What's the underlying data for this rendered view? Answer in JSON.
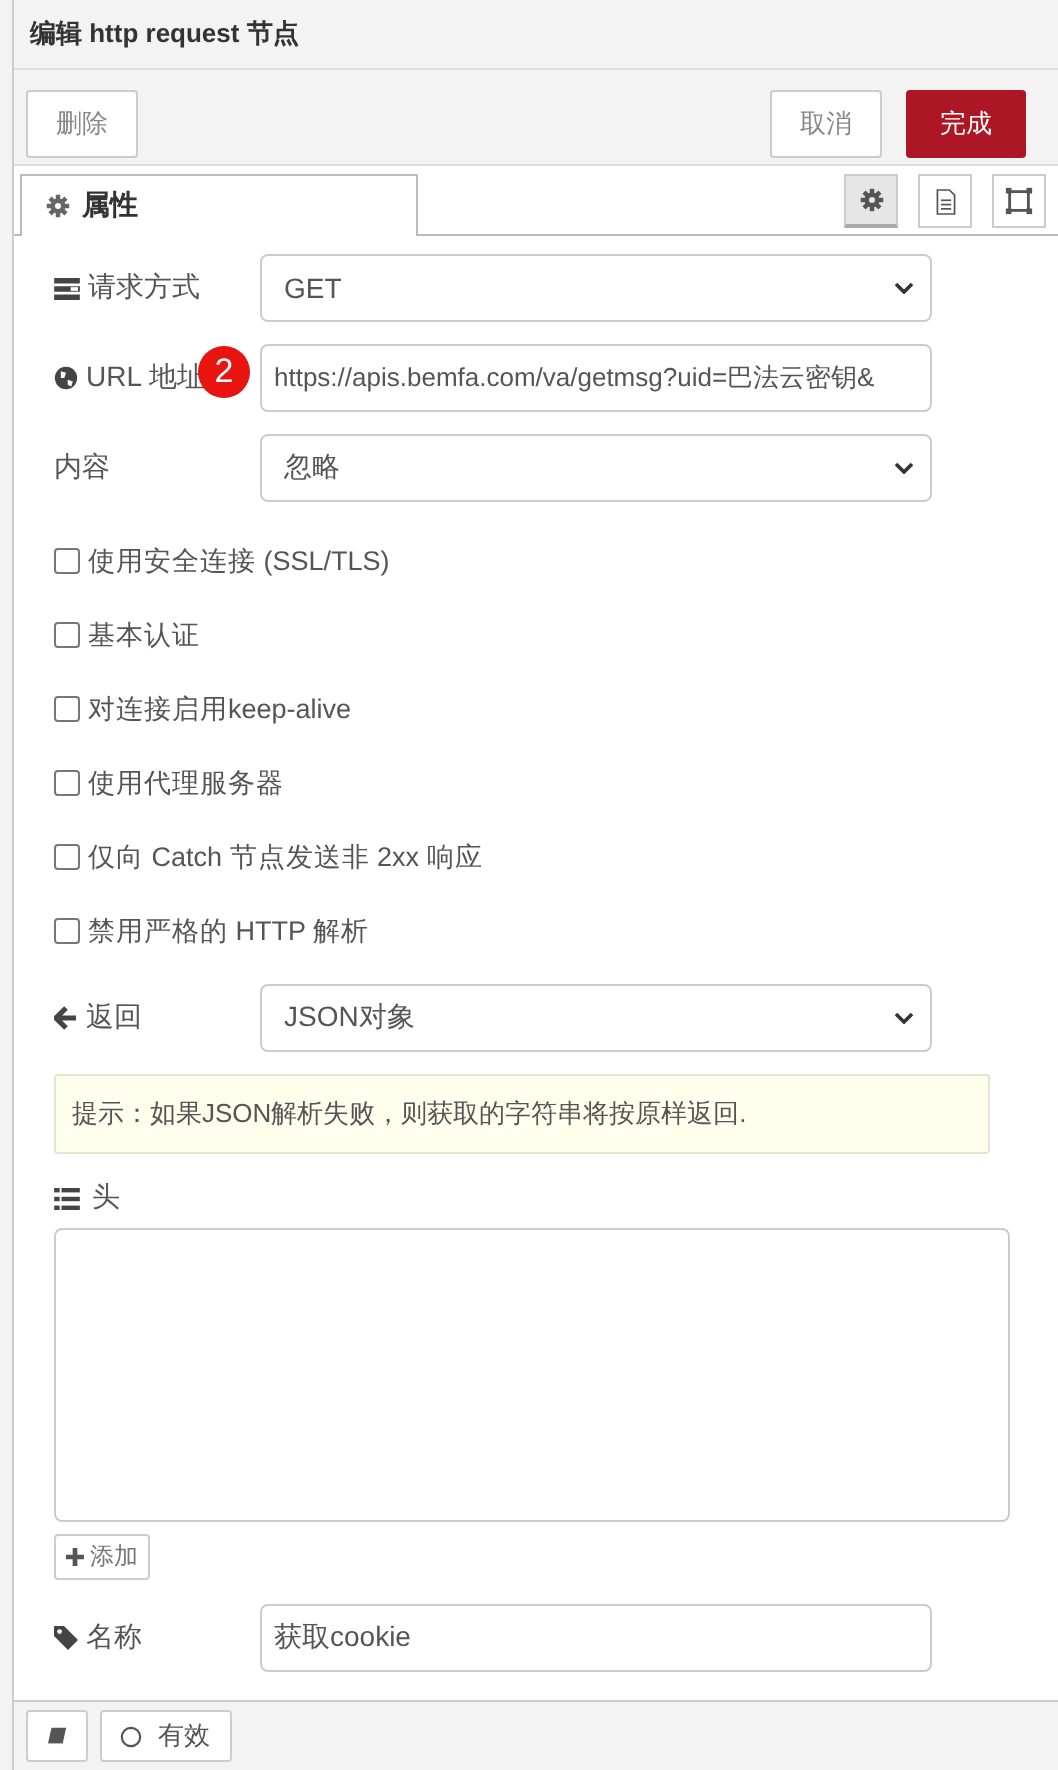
{
  "title": "编辑 http request 节点",
  "buttons": {
    "delete": "删除",
    "cancel": "取消",
    "done": "完成"
  },
  "tabs": [
    {
      "label": "属性",
      "selected": true
    }
  ],
  "tab_tools": [
    {
      "kind": "settings",
      "selected": true
    },
    {
      "kind": "description",
      "selected": false
    },
    {
      "kind": "appearance",
      "selected": false
    }
  ],
  "method": {
    "label": "请求方式",
    "value": "GET"
  },
  "url": {
    "label": "URL 地址",
    "value": "https://apis.bemfa.com/va/getmsg?uid=巴法云密钥&",
    "badge": "2"
  },
  "payload": {
    "label": "内容",
    "value": "忽略"
  },
  "options": [
    {
      "label": "使用安全连接 (SSL/TLS)",
      "checked": false
    },
    {
      "label": "基本认证",
      "checked": false
    },
    {
      "label": "对连接启用keep-alive",
      "checked": false
    },
    {
      "label": "使用代理服务器",
      "checked": false
    },
    {
      "label": "仅向 Catch 节点发送非 2xx 响应",
      "checked": false
    },
    {
      "label": "禁用严格的 HTTP 解析",
      "checked": false
    }
  ],
  "return": {
    "label": "返回",
    "value": "JSON对象"
  },
  "tip": "提示：如果JSON解析失败，则获取的字符串将按原样返回.",
  "headers": {
    "label": "头",
    "add_button": "添加"
  },
  "name": {
    "label": "名称",
    "value": "获取cookie"
  },
  "footer": {
    "enabled_label": "有效"
  }
}
